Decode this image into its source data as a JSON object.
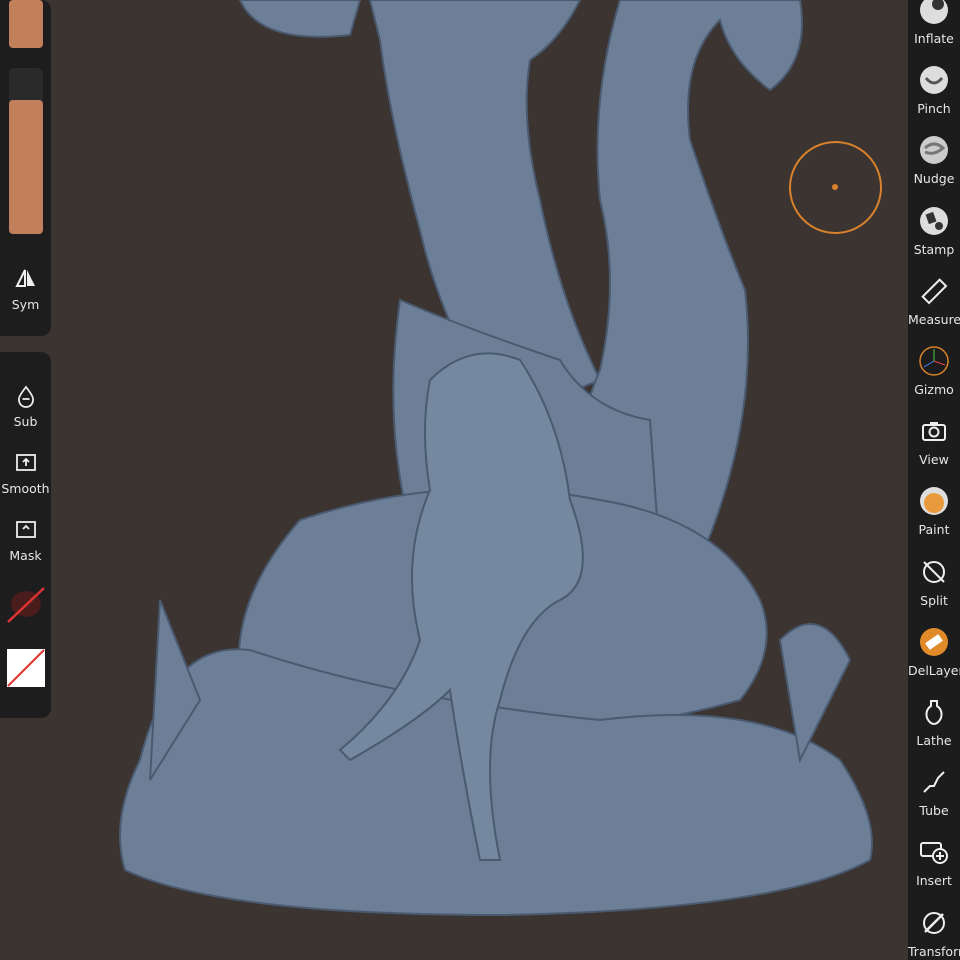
{
  "left_toolbar": {
    "colors": {
      "swatch": "#c17f5c"
    },
    "sym_label": "Sym",
    "tools": [
      {
        "label": "Sub",
        "icon": "droplet-minus-icon"
      },
      {
        "label": "Smooth",
        "icon": "square-up-arrow-icon"
      },
      {
        "label": "Mask",
        "icon": "square-caret-icon"
      }
    ]
  },
  "right_toolbar": {
    "tools": [
      {
        "label": "Inflate",
        "icon": "sphere-icon"
      },
      {
        "label": "Pinch",
        "icon": "pinch-sphere-icon"
      },
      {
        "label": "Nudge",
        "icon": "nudge-sphere-icon"
      },
      {
        "label": "Stamp",
        "icon": "stamp-sphere-icon"
      },
      {
        "label": "Measure",
        "icon": "ruler-icon"
      },
      {
        "label": "Gizmo",
        "icon": "gizmo-icon"
      },
      {
        "label": "View",
        "icon": "camera-icon"
      },
      {
        "label": "Paint",
        "icon": "paint-sphere-icon"
      },
      {
        "label": "Split",
        "icon": "split-icon"
      },
      {
        "label": "DelLayer",
        "icon": "layer-delete-icon"
      },
      {
        "label": "Lathe",
        "icon": "lathe-icon"
      },
      {
        "label": "Tube",
        "icon": "tube-icon"
      },
      {
        "label": "Insert",
        "icon": "insert-icon"
      },
      {
        "label": "Transform",
        "icon": "transform-icon"
      }
    ]
  },
  "colors": {
    "accent": "#d9822b",
    "model": "#6c7f97",
    "background": "#3b3431"
  }
}
